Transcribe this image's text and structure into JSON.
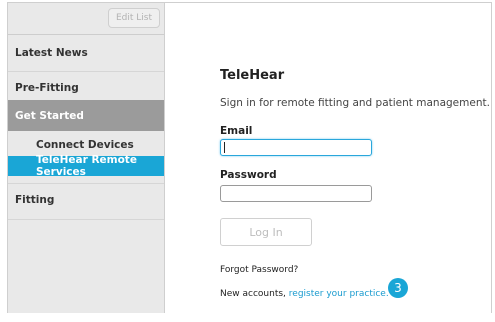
{
  "sidebar": {
    "edit_list_label": "Edit List",
    "items": {
      "latest_news": "Latest News",
      "pre_fitting": "Pre-Fitting",
      "get_started": "Get Started",
      "connect_devices": "Connect Devices",
      "telehear_remote_services": "TeleHear Remote Services",
      "fitting": "Fitting"
    },
    "active_color": "#1aa6d6",
    "section_color": "#9b9b9b"
  },
  "main": {
    "title": "TeleHear",
    "subtitle": "Sign in for remote fitting and patient management.",
    "email_label": "Email",
    "email_value": "",
    "password_label": "Password",
    "password_value": "",
    "login_label": "Log In",
    "forgot_password": "Forgot Password?",
    "new_accounts_prefix": "New accounts,",
    "register_link": "register your practice.",
    "callout_badge": "3"
  }
}
